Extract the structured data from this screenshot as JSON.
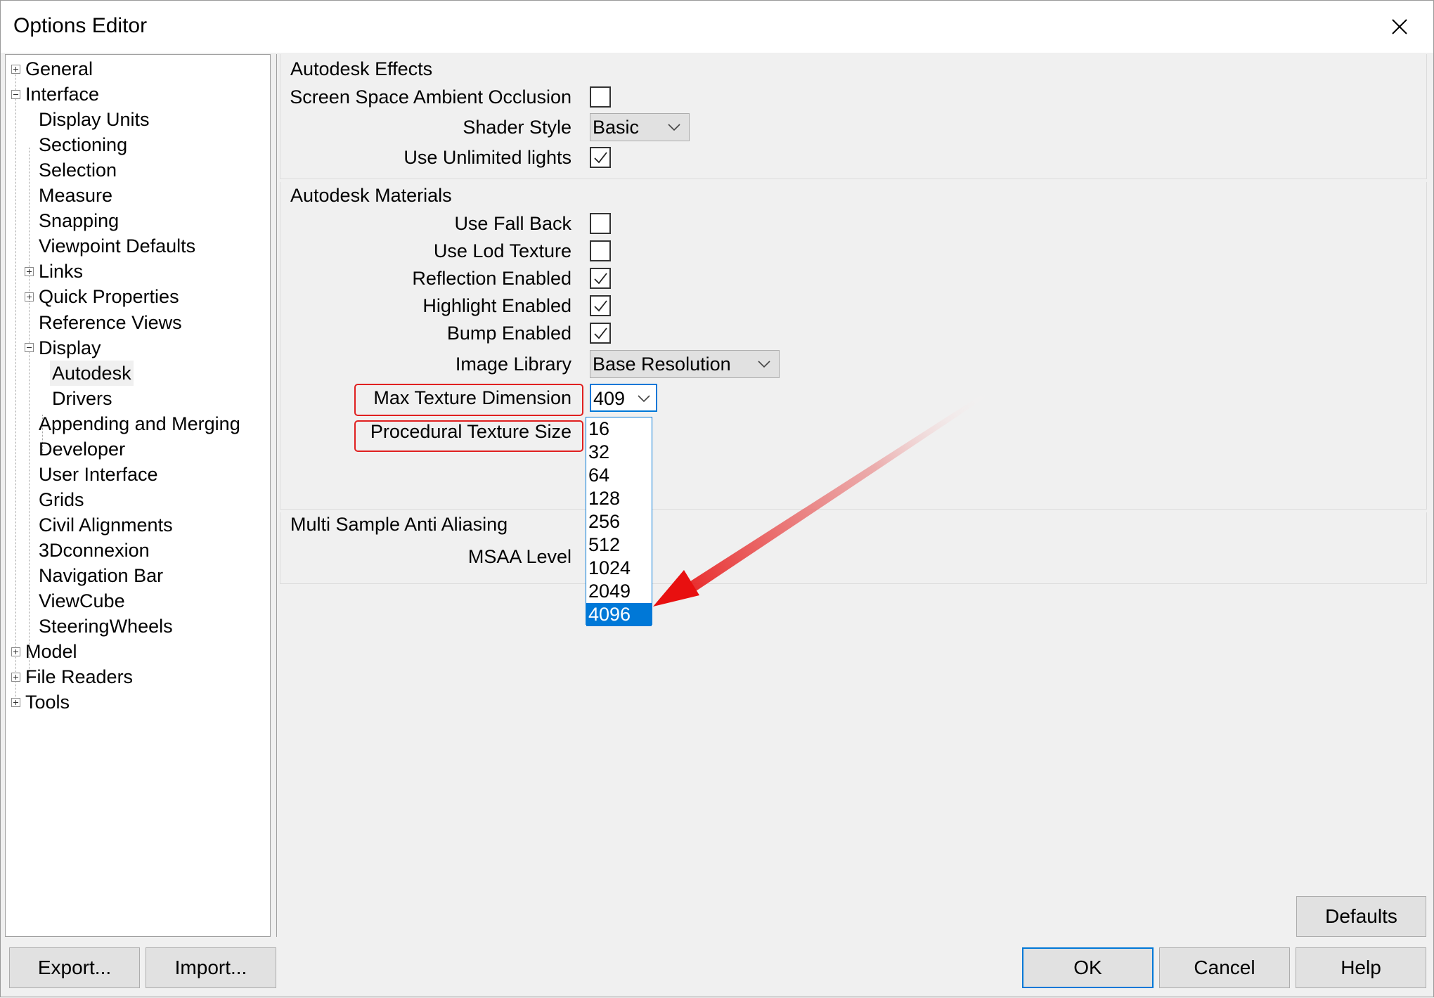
{
  "window": {
    "title": "Options Editor"
  },
  "tree": {
    "items": [
      {
        "label": "General",
        "expander": "plus"
      },
      {
        "label": "Interface",
        "expander": "minus"
      },
      {
        "label": "Display Units"
      },
      {
        "label": "Sectioning"
      },
      {
        "label": "Selection"
      },
      {
        "label": "Measure"
      },
      {
        "label": "Snapping"
      },
      {
        "label": "Viewpoint Defaults"
      },
      {
        "label": "Links",
        "expander": "plus"
      },
      {
        "label": "Quick Properties",
        "expander": "plus"
      },
      {
        "label": "Reference Views"
      },
      {
        "label": "Display",
        "expander": "minus"
      },
      {
        "label": "Autodesk",
        "selected": true
      },
      {
        "label": "Drivers"
      },
      {
        "label": "Appending and Merging"
      },
      {
        "label": "Developer"
      },
      {
        "label": "User Interface"
      },
      {
        "label": "Grids"
      },
      {
        "label": "Civil Alignments"
      },
      {
        "label": "3Dconnexion"
      },
      {
        "label": "Navigation Bar"
      },
      {
        "label": "ViewCube"
      },
      {
        "label": "SteeringWheels"
      },
      {
        "label": "Model",
        "expander": "plus"
      },
      {
        "label": "File Readers",
        "expander": "plus"
      },
      {
        "label": "Tools",
        "expander": "plus"
      }
    ]
  },
  "effects": {
    "title": "Autodesk Effects",
    "ssao_label": "Screen Space Ambient Occlusion",
    "ssao_checked": false,
    "shader_style_label": "Shader Style",
    "shader_style_value": "Basic",
    "unlimited_lights_label": "Use Unlimited lights",
    "unlimited_lights_checked": true
  },
  "materials": {
    "title": "Autodesk Materials",
    "fall_back_label": "Use Fall Back",
    "fall_back_checked": false,
    "lod_texture_label": "Use Lod Texture",
    "lod_texture_checked": false,
    "reflection_label": "Reflection Enabled",
    "reflection_checked": true,
    "highlight_label": "Highlight Enabled",
    "highlight_checked": true,
    "bump_label": "Bump Enabled",
    "bump_checked": true,
    "image_library_label": "Image Library",
    "image_library_value": "Base Resolution",
    "max_texture_label": "Max Texture Dimension",
    "max_texture_value": "409",
    "procedural_label": "Procedural Texture Size",
    "dropdown_options": [
      "16",
      "32",
      "64",
      "128",
      "256",
      "512",
      "1024",
      "2049",
      "4096"
    ],
    "dropdown_selected": "4096"
  },
  "msaa": {
    "title": "Multi Sample Anti Aliasing",
    "level_label": "MSAA Level"
  },
  "buttons": {
    "defaults": "Defaults",
    "export": "Export...",
    "import": "Import...",
    "ok": "OK",
    "cancel": "Cancel",
    "help": "Help"
  },
  "colors": {
    "accent": "#0078d7",
    "annotation": "#e02020"
  }
}
